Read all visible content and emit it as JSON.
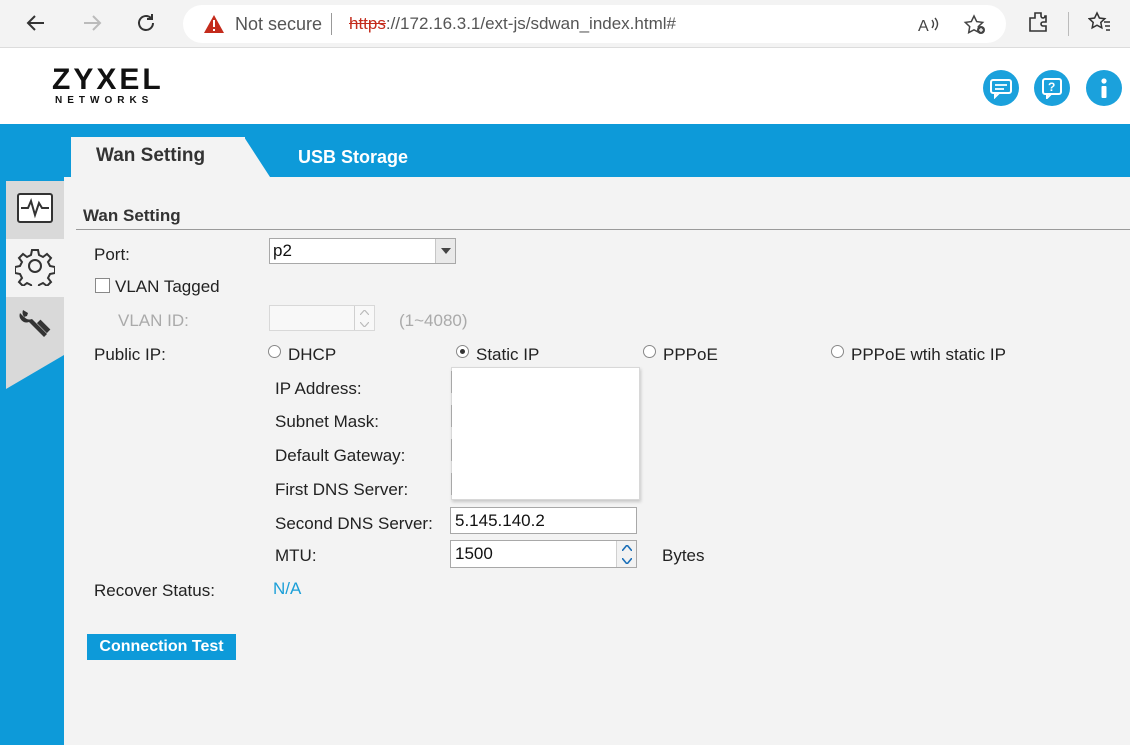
{
  "browser": {
    "security_label": "Not secure",
    "url_scheme": "https",
    "url_rest": "://172.16.3.1/ext-js/sdwan_index.html#",
    "icons": [
      "back-arrow-icon",
      "forward-arrow-icon",
      "refresh-icon",
      "warning-icon",
      "read-aloud-icon",
      "favorite-add-icon",
      "extensions-icon",
      "favorites-icon"
    ]
  },
  "app": {
    "logo_main": "ZYXEL",
    "logo_sub": "NETWORKS",
    "header_icons": [
      "chat-icon",
      "help-icon",
      "info-icon"
    ]
  },
  "tabs": [
    {
      "label": "Wan Setting",
      "active": true
    },
    {
      "label": "USB Storage",
      "active": false
    }
  ],
  "sidebar": {
    "items": [
      {
        "icon": "monitor-icon",
        "active": false
      },
      {
        "icon": "settings-gear-icon",
        "active": true
      },
      {
        "icon": "maintenance-tools-icon",
        "active": false
      }
    ]
  },
  "form": {
    "section_title": "Wan Setting",
    "port_label": "Port:",
    "port_value": "p2",
    "vlan_tagged_label": "VLAN Tagged",
    "vlan_tagged_checked": false,
    "vlan_id_label": "VLAN ID:",
    "vlan_id_value": "",
    "vlan_range_hint": "(1~4080)",
    "public_ip_label": "Public IP:",
    "public_ip_options": [
      {
        "label": "DHCP",
        "selected": false
      },
      {
        "label": "Static IP",
        "selected": true
      },
      {
        "label": "PPPoE",
        "selected": false
      },
      {
        "label": "PPPoE wtih static IP",
        "selected": false
      }
    ],
    "ip_address_label": "IP Address:",
    "ip_address_value": "",
    "subnet_mask_label": "Subnet Mask:",
    "subnet_mask_value": "",
    "default_gateway_label": "Default Gateway:",
    "default_gateway_value": "",
    "first_dns_label": "First DNS Server:",
    "first_dns_value": "",
    "second_dns_label": "Second DNS Server:",
    "second_dns_value": "5.145.140.2",
    "mtu_label": "MTU:",
    "mtu_value": "1500",
    "mtu_unit": "Bytes",
    "recover_status_label": "Recover Status:",
    "recover_status_value": "N/A",
    "connection_test_label": "Connection Test"
  },
  "colors": {
    "brand_blue": "#0d9ad9",
    "link_blue": "#1b9fd8",
    "warning_red": "#c42b1c"
  }
}
